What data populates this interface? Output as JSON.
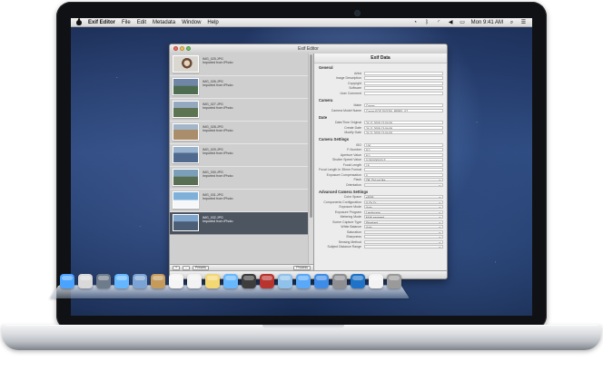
{
  "menubar": {
    "app_name": "Exif Editor",
    "items": [
      "File",
      "Edit",
      "Metadata",
      "Window",
      "Help"
    ],
    "clock": "Mon 9:41 AM"
  },
  "window": {
    "title": "Exif Editor",
    "right_title": "Exif Data",
    "photos": [
      {
        "name": "IMG_025.JPG",
        "subtitle": "Imported from iPhoto",
        "thumb": "t1"
      },
      {
        "name": "IMG_026.JPG",
        "subtitle": "Imported from iPhoto",
        "thumb": "t2"
      },
      {
        "name": "IMG_027.JPG",
        "subtitle": "Imported from iPhoto",
        "thumb": "t3"
      },
      {
        "name": "IMG_028.JPG",
        "subtitle": "Imported from iPhoto",
        "thumb": "t4"
      },
      {
        "name": "IMG_029.JPG",
        "subtitle": "Imported from iPhoto",
        "thumb": "t5"
      },
      {
        "name": "IMG_030.JPG",
        "subtitle": "Imported from iPhoto",
        "thumb": "t6"
      },
      {
        "name": "IMG_031.JPG",
        "subtitle": "Imported from iPhoto",
        "thumb": "t7"
      },
      {
        "name": "IMG_032.JPG",
        "subtitle": "Imported from iPhoto",
        "thumb": "t8"
      }
    ],
    "left_footer": {
      "add": "+",
      "remove": "-",
      "settings": "Presets",
      "action": "Process"
    },
    "sections": [
      {
        "title": "General",
        "fields": [
          {
            "label": "Artist",
            "value": ""
          },
          {
            "label": "Image Description",
            "value": ""
          },
          {
            "label": "Copyright",
            "value": ""
          },
          {
            "label": "Software",
            "value": ""
          },
          {
            "label": "User Comment",
            "value": ""
          }
        ]
      },
      {
        "title": "Camera",
        "fields": [
          {
            "label": "Make",
            "value": "Canon"
          },
          {
            "label": "Camera Model Name",
            "value": "Canon EOS DIGITAL REBEL XT"
          }
        ]
      },
      {
        "title": "Date",
        "fields": [
          {
            "label": "Date/Time Original",
            "value": "24.11.2009 13:04:06"
          },
          {
            "label": "Create Date",
            "value": "24.11.2009 13:04:06"
          },
          {
            "label": "Modify Date",
            "value": "24.11.2009 13:04:06"
          }
        ]
      },
      {
        "title": "Camera Settings",
        "fields": [
          {
            "label": "ISO",
            "value": "100"
          },
          {
            "label": "F-Number",
            "value": "8.0"
          },
          {
            "label": "Aperture Value",
            "value": "8.0"
          },
          {
            "label": "Shutter Speed Value",
            "value": "0.000000000 S"
          },
          {
            "label": "Focal Length",
            "value": "18"
          },
          {
            "label": "Focal Length In 35mm Format",
            "value": ""
          },
          {
            "label": "Exposure Compensation",
            "value": "0"
          },
          {
            "label": "Flash",
            "value": "Off, Did not fire",
            "select": true
          },
          {
            "label": "Orientation",
            "value": "",
            "select": true
          }
        ]
      },
      {
        "title": "Advanced Camera Settings",
        "fields": [
          {
            "label": "Color Space",
            "value": "sRGB",
            "select": true
          },
          {
            "label": "Components Configuration",
            "value": "Y Cb Cr -",
            "select": true
          },
          {
            "label": "Exposure Mode",
            "value": "Auto",
            "select": true
          },
          {
            "label": "Exposure Program",
            "value": "Landscape",
            "select": true
          },
          {
            "label": "Metering Mode",
            "value": "Multi-segment",
            "select": true
          },
          {
            "label": "Scene Capture Type",
            "value": "Standard",
            "select": true
          },
          {
            "label": "White Balance",
            "value": "Auto",
            "select": true
          },
          {
            "label": "Saturation",
            "value": "",
            "select": true
          },
          {
            "label": "Sharpness",
            "value": "",
            "select": true
          },
          {
            "label": "Sensing Method",
            "value": "",
            "select": true
          },
          {
            "label": "Subject Distance Range",
            "value": "",
            "select": true
          }
        ]
      }
    ]
  },
  "dock": {
    "icons": [
      {
        "name": "finder-icon",
        "color": "#4aa3ff"
      },
      {
        "name": "launchpad-icon",
        "color": "#d9d9d9"
      },
      {
        "name": "mission-control-icon",
        "color": "#6e7b8b"
      },
      {
        "name": "safari-icon",
        "color": "#64b7ff"
      },
      {
        "name": "mail-icon",
        "color": "#7ba3d4"
      },
      {
        "name": "contacts-icon",
        "color": "#c59b5c"
      },
      {
        "name": "calendar-icon",
        "color": "#f5f5f5"
      },
      {
        "name": "reminders-icon",
        "color": "#f2f2f2"
      },
      {
        "name": "notes-icon",
        "color": "#f2d773"
      },
      {
        "name": "messages-icon",
        "color": "#67b8ff"
      },
      {
        "name": "facetime-icon",
        "color": "#3d3d3d"
      },
      {
        "name": "photo-booth-icon",
        "color": "#b8342f"
      },
      {
        "name": "iphoto-icon",
        "color": "#8fc1ea"
      },
      {
        "name": "itunes-icon",
        "color": "#5aa8f8"
      },
      {
        "name": "app-store-icon",
        "color": "#3f8ce8"
      },
      {
        "name": "system-preferences-icon",
        "color": "#8e8e93"
      },
      {
        "name": "preview-icon",
        "color": "#1e73c8"
      },
      {
        "name": "documents-icon",
        "color": "#f3f3f3"
      },
      {
        "name": "trash-icon",
        "color": "#9a9a9a"
      }
    ]
  }
}
